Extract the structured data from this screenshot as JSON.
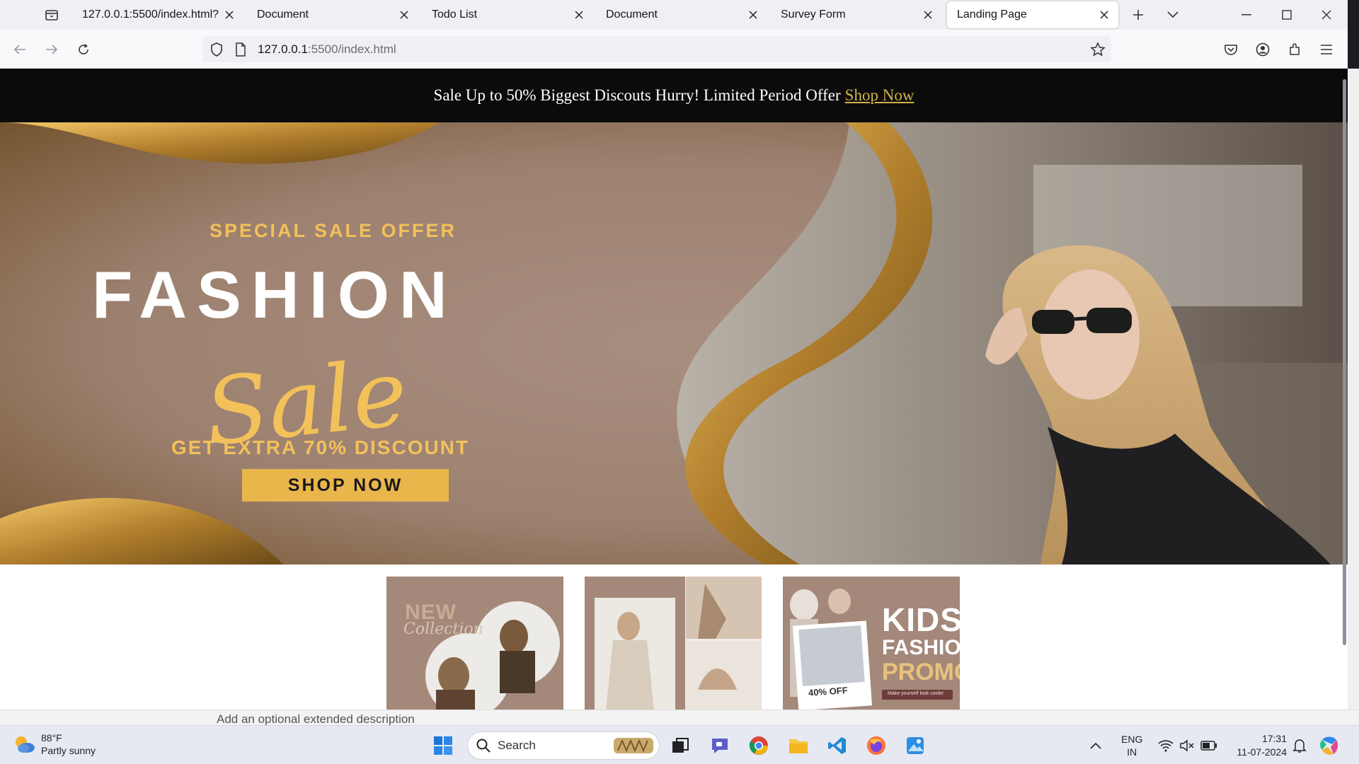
{
  "browser": {
    "tabs": [
      {
        "title": "127.0.0.1:5500/index.html?",
        "active": false
      },
      {
        "title": "Document",
        "active": false
      },
      {
        "title": "Todo List",
        "active": false
      },
      {
        "title": "Document",
        "active": false
      },
      {
        "title": "Survey Form",
        "active": false
      },
      {
        "title": "Landing Page",
        "active": true
      }
    ],
    "url_host": "127.0.0.1",
    "url_rest": ":5500/index.html"
  },
  "page": {
    "promo_text": "Sale Up to 50% Biggest Discouts Hurry! Limited Period Offer",
    "promo_link": "Shop Now",
    "hero": {
      "subtitle": "SPECIAL SALE OFFER",
      "title": "FASHION",
      "script": "Sale",
      "discount": "GET EXTRA 70% DISCOUNT",
      "button": "SHOP NOW"
    },
    "cards": [
      {
        "line1": "NEW",
        "line2": "Collection"
      },
      {},
      {
        "line1": "KIDS",
        "line2": "FASHION",
        "line3": "PROMO",
        "badge": "40% OFF",
        "tagline": "Make yourself look cooler"
      }
    ]
  },
  "behind_window_text": "Add an optional extended description",
  "taskbar": {
    "weather_temp": "88°F",
    "weather_desc": "Partly sunny",
    "search_label": "Search",
    "language_top": "ENG",
    "language_bottom": "IN",
    "time": "17:31",
    "date": "11-07-2024"
  },
  "colors": {
    "accent_gold": "#f2c15a",
    "promo_link": "#d4b34a",
    "hero_bg": "#a4887a"
  }
}
